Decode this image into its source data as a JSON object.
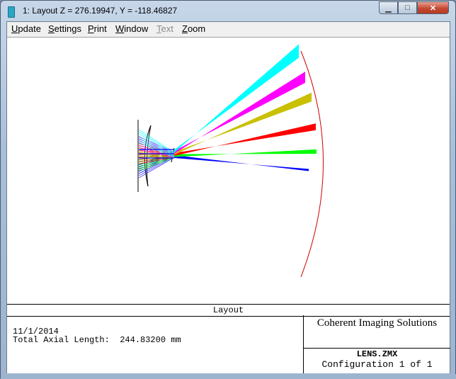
{
  "window": {
    "title": "1: Layout Z = 276.19947, Y = -118.46827",
    "minimize_glyph": "▁",
    "maximize_glyph": "□",
    "close_glyph": "✕"
  },
  "menu": [
    {
      "label": "Update",
      "u": "U",
      "rest": "pdate",
      "enabled": true
    },
    {
      "label": "Settings",
      "u": "S",
      "rest": "ettings",
      "enabled": true
    },
    {
      "label": "Print",
      "u": "P",
      "rest": "rint",
      "enabled": true
    },
    {
      "label": "Window",
      "u": "W",
      "rest": "indow",
      "enabled": true
    },
    {
      "label": "Text",
      "u": "T",
      "rest": "ext",
      "enabled": false
    },
    {
      "label": "Zoom",
      "u": "Z",
      "rest": "oom",
      "enabled": true
    }
  ],
  "info": {
    "panel_title": "Layout",
    "date": "11/1/2014",
    "axial_length": "Total Axial Length:  244.83200 mm",
    "company": "Coherent Imaging Solutions",
    "file": "LENS.ZMX",
    "configuration": "Configuration 1 of 1"
  },
  "colors": {
    "field1": "#0000ff",
    "field2": "#00ff00",
    "field3": "#ff0000",
    "field4": "#c8c000",
    "field5": "#ff00ff",
    "field6": "#00ffff",
    "image_surface": "#cc0000"
  }
}
